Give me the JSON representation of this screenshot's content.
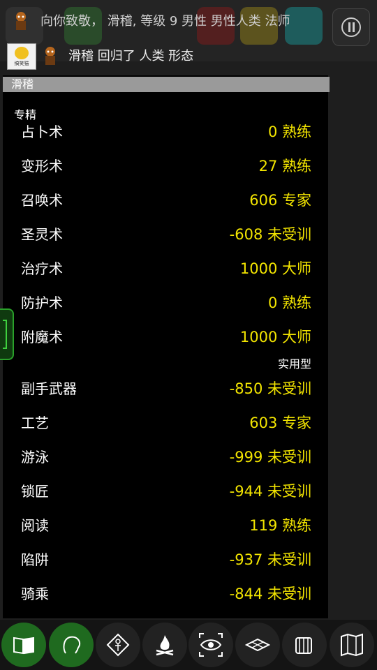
{
  "messages": [
    {
      "text": "向你致敬，  滑稽, 等级 9 男性 男性人类 法师"
    },
    {
      "text": "滑稽 回归了 人类 形态"
    }
  ],
  "panel": {
    "title": "滑稽",
    "sections": [
      {
        "label": "专精",
        "skills": [
          {
            "name": "占卜术",
            "value": "0 熟练"
          },
          {
            "name": "变形术",
            "value": "27 熟练"
          },
          {
            "name": "召唤术",
            "value": "606 专家"
          },
          {
            "name": "圣灵术",
            "value": "-608 未受训"
          },
          {
            "name": "治疗术",
            "value": "1000 大师"
          },
          {
            "name": "防护术",
            "value": "0 熟练"
          },
          {
            "name": "附魔术",
            "value": "1000 大师"
          }
        ]
      },
      {
        "label": "实用型",
        "skills": [
          {
            "name": "副手武器",
            "value": "-850 未受训"
          },
          {
            "name": "工艺",
            "value": "603 专家"
          },
          {
            "name": "游泳",
            "value": "-999 未受训"
          },
          {
            "name": "锁匠",
            "value": "-944 未受训"
          },
          {
            "name": "阅读",
            "value": "119 熟练"
          },
          {
            "name": "陷阱",
            "value": "-937 未受训"
          },
          {
            "name": "骑乘",
            "value": "-844 未受训"
          }
        ]
      }
    ]
  },
  "avatar_badge_text": "搞笑猫",
  "colors": {
    "skill_value": "#f3e500",
    "active_button": "#1f6a1f",
    "title_bar": "#9a9a9a"
  },
  "bottom_buttons": [
    {
      "icon": "book-icon",
      "active": true
    },
    {
      "icon": "head-outline-icon",
      "active": true
    },
    {
      "icon": "ankh-diamond-icon",
      "active": false
    },
    {
      "icon": "campfire-icon",
      "active": false
    },
    {
      "icon": "eye-target-icon",
      "active": false
    },
    {
      "icon": "map-tile-icon",
      "active": false
    },
    {
      "icon": "inventory-hand-icon",
      "active": false
    },
    {
      "icon": "world-map-icon",
      "active": false
    }
  ]
}
